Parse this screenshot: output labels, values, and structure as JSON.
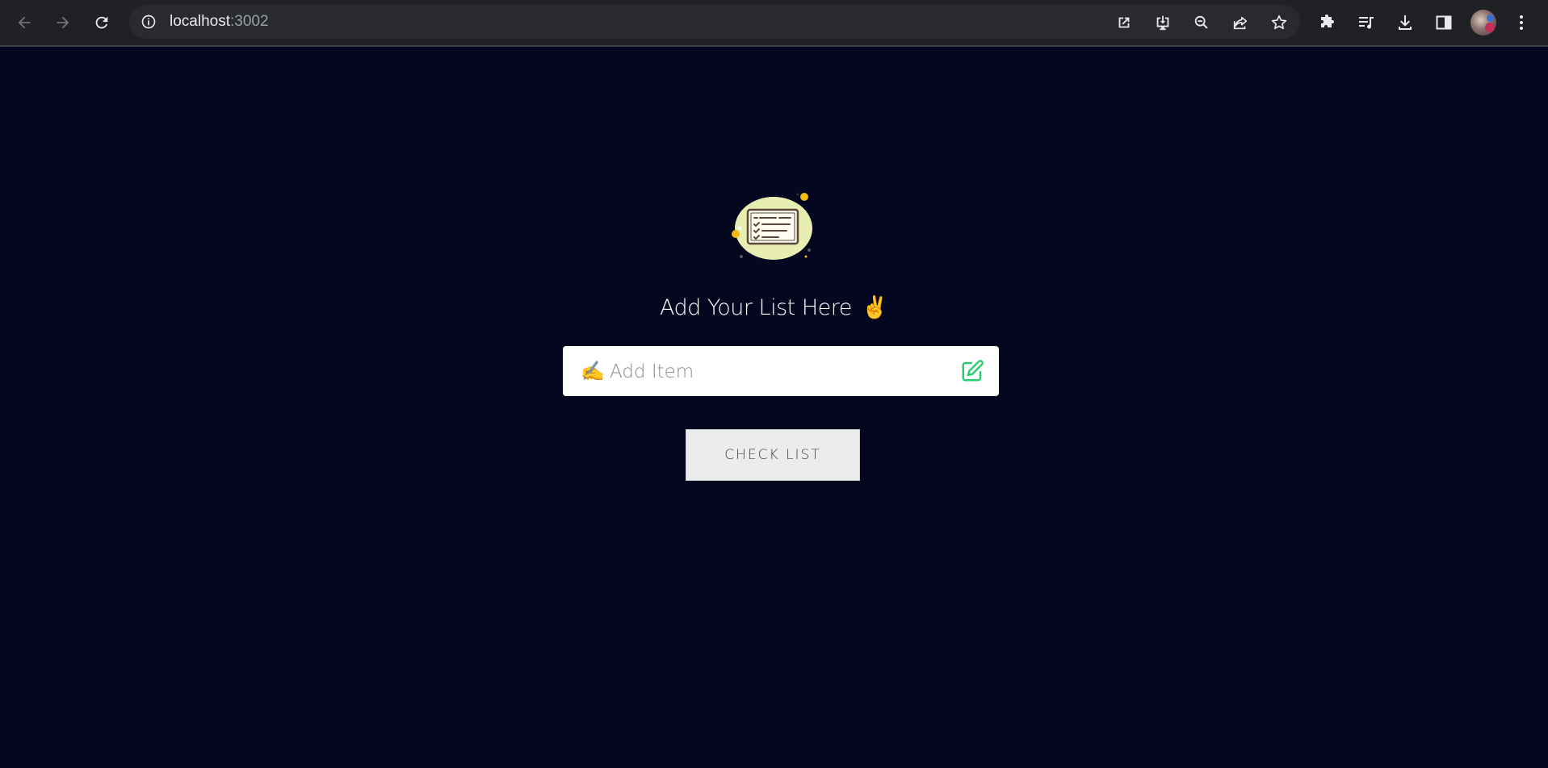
{
  "browser": {
    "url_host": "localhost",
    "url_port": ":3002",
    "icons": {
      "back": "back-arrow-icon",
      "forward": "forward-arrow-icon",
      "reload": "reload-icon",
      "site_info": "info-icon",
      "open_in_app": "open-external-icon",
      "install": "install-icon",
      "zoom": "zoom-out-icon",
      "share": "share-icon",
      "bookmark": "star-icon",
      "extensions": "puzzle-icon",
      "media": "media-queue-icon",
      "downloads": "download-icon",
      "side_panel": "side-panel-icon",
      "menu": "kebab-menu-icon"
    }
  },
  "app": {
    "heading": "Add Your List Here",
    "heading_emoji": "✌️",
    "input": {
      "emoji": "✍️",
      "placeholder": "Add Item",
      "value": ""
    },
    "check_button_label": "CHECK LIST"
  },
  "colors": {
    "background": "#050720",
    "edit_icon": "#2ecc71",
    "input_bg": "#ffffff",
    "button_bg": "#ececec"
  }
}
